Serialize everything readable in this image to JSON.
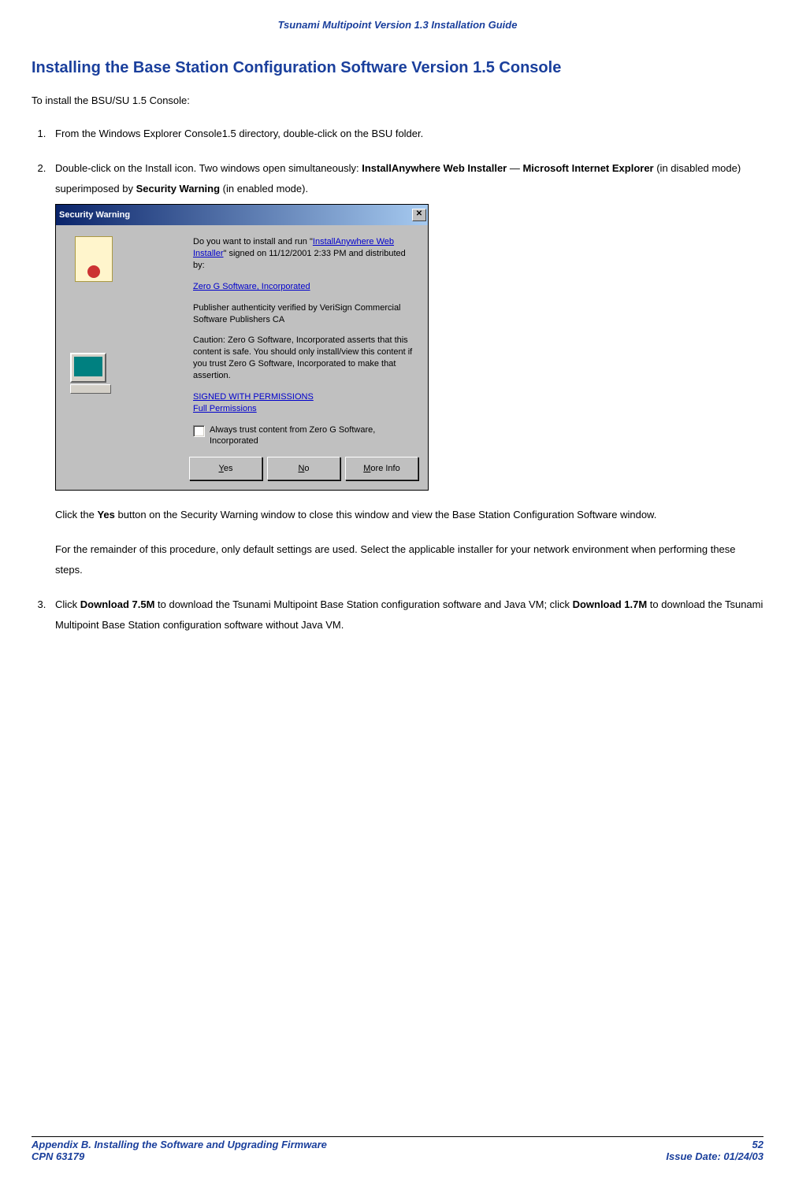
{
  "header": {
    "title": "Tsunami Multipoint Version 1.3 Installation Guide"
  },
  "section": {
    "title": "Installing the Base Station Configuration Software Version 1.5 Console"
  },
  "intro": "To install the BSU/SU 1.5 Console:",
  "steps": {
    "s1": "From the Windows Explorer Console1.5 directory, double-click on the BSU folder.",
    "s2_a": "Double-click on the Install icon.  Two windows open simultaneously:  ",
    "s2_b1": "InstallAnywhere Web Installer",
    "s2_dash": " — ",
    "s2_b2": "Microsoft Internet Explorer",
    "s2_c": " (in disabled mode) superimposed by ",
    "s2_b3": "Security Warning",
    "s2_d": " (in enabled mode).",
    "s2_after_a": "Click the ",
    "s2_after_b": "Yes",
    "s2_after_c": " button on the Security Warning window to close this window and view the Base Station Configuration Software window.",
    "s2_after2": "For the remainder of this procedure, only default settings are used.  Select the applicable installer for your network environment when performing these steps.",
    "s3_a": "Click ",
    "s3_b1": "Download 7.5M",
    "s3_c": " to download the Tsunami Multipoint Base Station configuration software and Java VM; click ",
    "s3_b2": "Download 1.7M",
    "s3_d": " to download the Tsunami Multipoint Base Station configuration software without Java VM."
  },
  "dialog": {
    "title": "Security Warning",
    "p1_a": "Do you want to install and run \"",
    "p1_link": "InstallAnywhere Web Installer",
    "p1_b": "\" signed on 11/12/2001 2:33 PM and distributed by:",
    "vendor_link": "Zero G Software, Incorporated",
    "p2": "Publisher authenticity verified by VeriSign Commercial Software Publishers CA",
    "p3": "Caution: Zero G Software, Incorporated asserts that this content is safe.  You should only install/view this content if you trust Zero G Software, Incorporated to make that assertion.",
    "perm1": "SIGNED WITH PERMISSIONS",
    "perm2": "Full Permissions",
    "checkbox_label": "Always trust content from Zero G Software, Incorporated",
    "btn_yes_accel": "Y",
    "btn_yes_rest": "es",
    "btn_no_accel": "N",
    "btn_no_rest": "o",
    "btn_more_accel": "M",
    "btn_more_rest": "ore Info"
  },
  "footer": {
    "left1": "Appendix B. Installing the Software and Upgrading Firmware",
    "right1": "52",
    "left2": "CPN 63179",
    "right2": "Issue Date:  01/24/03"
  }
}
